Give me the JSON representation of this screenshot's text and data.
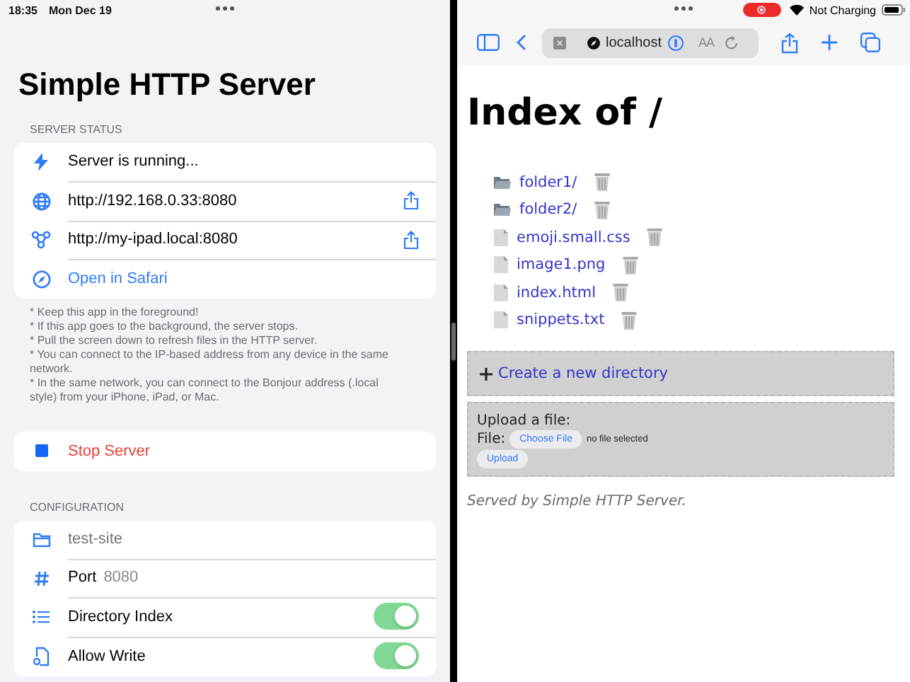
{
  "left_status_bar": {
    "time": "18:35",
    "date": "Mon Dec 19"
  },
  "title": "Simple HTTP Server",
  "server_status": {
    "header": "SERVER STATUS",
    "rows": [
      {
        "kind": "status",
        "text": "Server is running..."
      },
      {
        "kind": "address",
        "text": "http://192.168.0.33:8080"
      },
      {
        "kind": "address",
        "text": "http://my-ipad.local:8080"
      },
      {
        "kind": "link",
        "text": "Open in Safari"
      }
    ]
  },
  "notes": [
    "* Keep this app in the foreground!",
    "* If this app goes to the background, the server stops.",
    "* Pull the screen down to refresh files in the HTTP server.",
    "* You can connect to the IP-based address from any device in the same network.",
    "* In the same network, you can connect to the Bonjour address (.local style) from your iPhone, iPad, or Mac."
  ],
  "stop_button": "Stop Server",
  "configuration": {
    "header": "CONFIGURATION",
    "rows": [
      {
        "kind": "field",
        "placeholder": "test-site"
      },
      {
        "kind": "port",
        "label": "Port",
        "value": "8080"
      },
      {
        "kind": "toggle",
        "label": "Directory Index",
        "on": true
      },
      {
        "kind": "toggle",
        "label": "Allow Write",
        "on": true
      }
    ]
  },
  "right_status_bar": {
    "battery": "Not Charging"
  },
  "browser": {
    "address": "localhost",
    "reader_label": "AA"
  },
  "page": {
    "heading": "Index of /",
    "entries": [
      {
        "kind": "folder",
        "name": "folder1/"
      },
      {
        "kind": "folder",
        "name": "folder2/"
      },
      {
        "kind": "file",
        "name": "emoji.small.css"
      },
      {
        "kind": "file",
        "name": "image1.png"
      },
      {
        "kind": "file",
        "name": "index.html"
      },
      {
        "kind": "file",
        "name": "snippets.txt"
      }
    ],
    "create_link": "Create a new directory",
    "upload": {
      "title": "Upload a file:",
      "field_label": "File:",
      "choose_button": "Choose File",
      "file_status": "no file selected",
      "upload_button": "Upload"
    },
    "footer": "Served by Simple HTTP Server."
  }
}
